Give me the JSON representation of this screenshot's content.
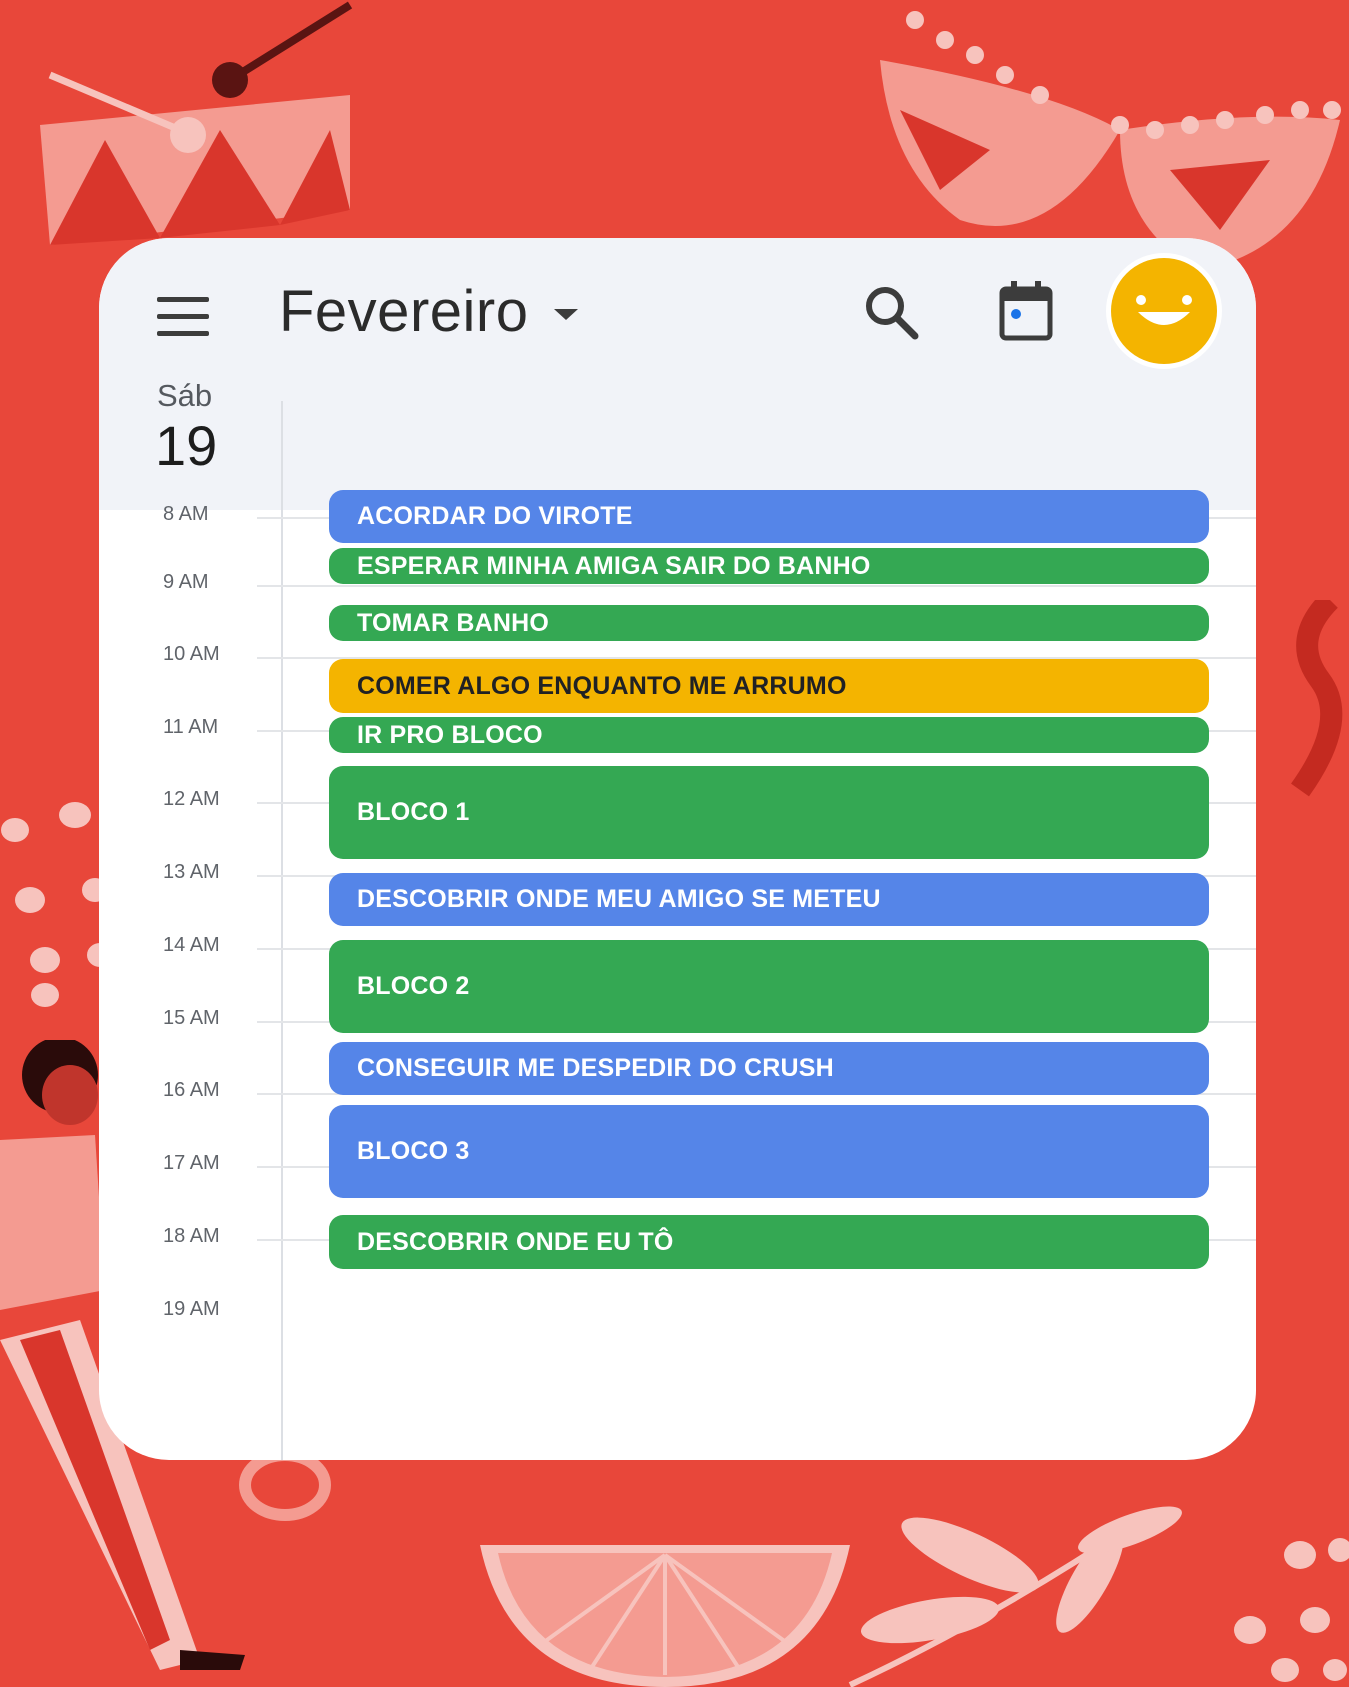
{
  "header": {
    "month_title": "Fevereiro",
    "weekday": "Sáb",
    "day_number": "19"
  },
  "icons": {
    "menu": "menu-icon",
    "dropdown": "chevron-down-icon",
    "search": "search-icon",
    "calendar": "calendar-icon",
    "avatar": "smiley-avatar"
  },
  "colors": {
    "background": "#e8473a",
    "blue_event": "#5585e8",
    "green_event": "#34a853",
    "yellow_event": "#f4b400",
    "avatar": "#f4b400"
  },
  "hours": [
    "8 AM",
    "9 AM",
    "10 AM",
    "11 AM",
    "12 AM",
    "13 AM",
    "14 AM",
    "15 AM",
    "16 AM",
    "17 AM",
    "18 AM",
    "19 AM"
  ],
  "events": [
    {
      "title": "ACORDAR DO VIROTE",
      "color": "blue"
    },
    {
      "title": "ESPERAR MINHA AMIGA SAIR DO BANHO",
      "color": "green"
    },
    {
      "title": "TOMAR BANHO",
      "color": "green"
    },
    {
      "title": "COMER ALGO ENQUANTO ME ARRUMO",
      "color": "yellow"
    },
    {
      "title": "IR PRO BLOCO",
      "color": "green"
    },
    {
      "title": "BLOCO 1",
      "color": "green"
    },
    {
      "title": "DESCOBRIR ONDE MEU AMIGO SE METEU",
      "color": "blue"
    },
    {
      "title": "BLOCO 2",
      "color": "green"
    },
    {
      "title": "CONSEGUIR ME DESPEDIR DO CRUSH",
      "color": "blue"
    },
    {
      "title": "BLOCO 3",
      "color": "blue"
    },
    {
      "title": "DESCOBRIR ONDE EU TÔ",
      "color": "green"
    }
  ]
}
